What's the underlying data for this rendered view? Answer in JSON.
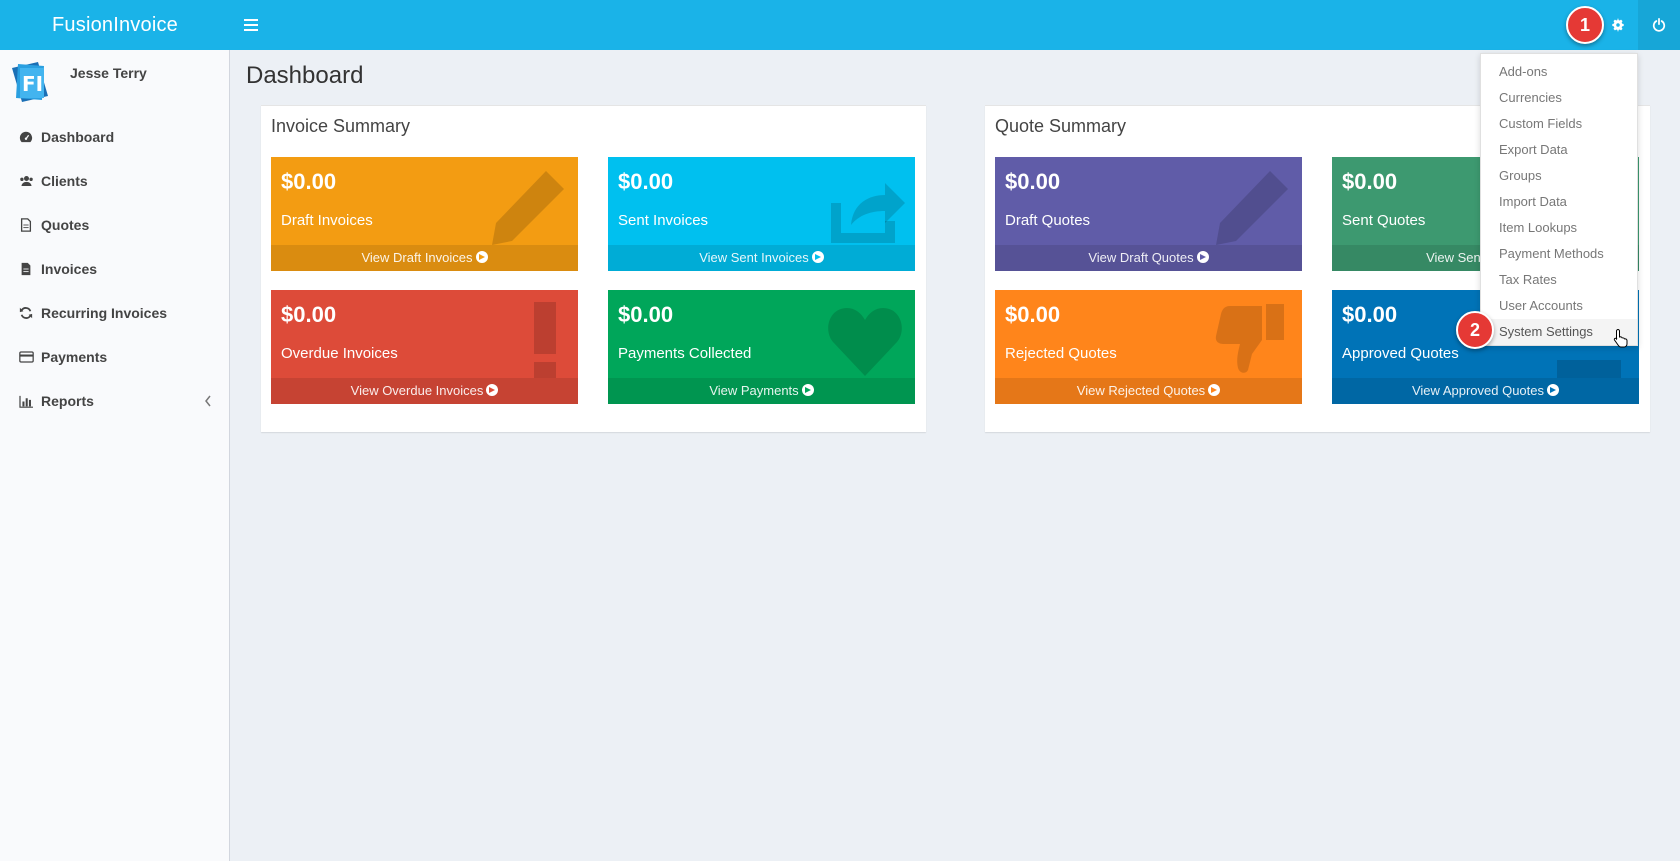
{
  "header": {
    "brand": "FusionInvoice",
    "menu_icon": "bars-icon",
    "settings_icon": "gear-icon",
    "logout_icon": "power-icon"
  },
  "sidebar": {
    "user_name": "Jesse Terry",
    "items": [
      {
        "label": "Dashboard",
        "icon": "dashboard-icon"
      },
      {
        "label": "Clients",
        "icon": "users-icon"
      },
      {
        "label": "Quotes",
        "icon": "file-icon"
      },
      {
        "label": "Invoices",
        "icon": "file-text-icon"
      },
      {
        "label": "Recurring Invoices",
        "icon": "refresh-icon"
      },
      {
        "label": "Payments",
        "icon": "credit-card-icon"
      },
      {
        "label": "Reports",
        "icon": "bar-chart-icon"
      }
    ]
  },
  "page": {
    "title": "Dashboard"
  },
  "invoice_summary": {
    "title": "Invoice Summary",
    "tiles": [
      {
        "amount": "$0.00",
        "label": "Draft Invoices",
        "link": "View Draft Invoices",
        "color": "#f39c12",
        "icon": "pencil-icon"
      },
      {
        "amount": "$0.00",
        "label": "Sent Invoices",
        "link": "View Sent Invoices",
        "color": "#00c0ef",
        "icon": "share-icon"
      },
      {
        "amount": "$0.00",
        "label": "Overdue Invoices",
        "link": "View Overdue Invoices",
        "color": "#dd4b39",
        "icon": "exclamation-icon"
      },
      {
        "amount": "$0.00",
        "label": "Payments Collected",
        "link": "View Payments",
        "color": "#00a65a",
        "icon": "heart-icon"
      }
    ]
  },
  "quote_summary": {
    "title": "Quote Summary",
    "tiles": [
      {
        "amount": "$0.00",
        "label": "Draft Quotes",
        "link": "View Draft Quotes",
        "color": "#605ca8",
        "icon": "pencil-icon"
      },
      {
        "amount": "$0.00",
        "label": "Sent Quotes",
        "link": "View Sent Quotes",
        "color": "#3d9970",
        "icon": "share-icon"
      },
      {
        "amount": "$0.00",
        "label": "Rejected Quotes",
        "link": "View Rejected Quotes",
        "color": "#ff851b",
        "icon": "thumbs-down-icon"
      },
      {
        "amount": "$0.00",
        "label": "Approved Quotes",
        "link": "View Approved Quotes",
        "color": "#0073b7",
        "icon": "thumbs-up-icon"
      }
    ]
  },
  "settings_menu": {
    "items": [
      "Add-ons",
      "Currencies",
      "Custom Fields",
      "Export Data",
      "Groups",
      "Import Data",
      "Item Lookups",
      "Payment Methods",
      "Tax Rates",
      "User Accounts",
      "System Settings"
    ]
  },
  "callouts": {
    "step1": "1",
    "step2": "2"
  }
}
